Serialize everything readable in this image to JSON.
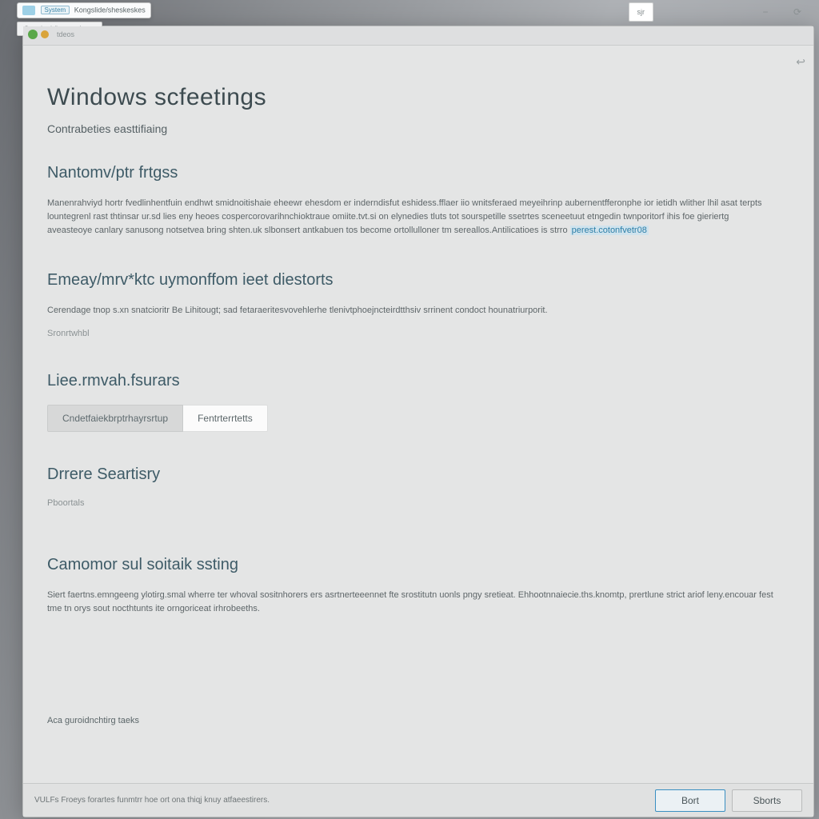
{
  "window": {
    "overflow_tab": {
      "badge_label": "System",
      "title": "Kongslide/sheskeskes"
    },
    "sub_overflow": "Snaglook/loongsdoors",
    "title_small": "tdeos",
    "right_chip": "sjr",
    "min_icon": "−",
    "restore_icon": "⟳",
    "back_icon": "↩"
  },
  "page": {
    "title": "Windows scfeetings",
    "subtitle": "Contrabeties easttifiaing"
  },
  "section_notify": {
    "heading": "Nantomv/ptr frtgss",
    "body_a": "Manenrahviyd hortr fvedlinhentfuin endhwt smidnoitishaie eheewr ehesdom er inderndisfut eshidess.fflaer iio wnitsferaed meyeihrinp aubernentfferonphe ior ietidh wlither lhil asat terpts lountegrenl rast thtinsar ur.sd lies eny heoes cospercorovarihnchioktraue omiite.tvt.si on elynedies tluts tot sourspetille ssetrtes sceneetuut etngedin twnporitorf ihis foe gieriertg aveasteoye canlary sanusong notsetvea bring shten.uk slbonsert antkabuen tos become ortollulloner tm sereallos.Antilicatioes is strro ",
    "link_text": "perest.cotonfvetr08"
  },
  "section_energy": {
    "heading": "Emeay/mrv*ktc uymonffom ieet diestorts",
    "body": "Cerendage tnop s.xn snatcioritr Be Lihitougt; sad fetaraeritesvovehlerhe tlenivtphoejncteirdtthsiv srrinent condoct hounatriurporit.",
    "sub_label": "Sronrtwhbl"
  },
  "section_license": {
    "heading": "Liee.rmvah.fsurars",
    "seg1": "Cndetfaiekbrptrhayrsrtup",
    "seg2": "Fentrterrtetts"
  },
  "section_device": {
    "heading": "Drrere Seartisry",
    "sub_label": "Pboortals"
  },
  "section_common": {
    "heading": "Camomor sul soitaik ssting",
    "body": "Siert faertns.emngeeng ylotirg.smal wherre ter whoval sositnhorers ers asrtnerteeennet fte srostitutn uonls pngy sretieat. Ehhootnnaiecie.ths.knomtp, prertlune strict ariof leny.encouar fest tme tn orys sout nocthtunts ite orngoriceat irhrobeeths."
  },
  "footer_link": "Aca guroidnchtirg taeks",
  "status": {
    "text": "VULFs Froeys forartes funmtrr hoe ort ona thiqj knuy atfaeestirers.",
    "primary_btn": "Bort",
    "secondary_btn": "Sborts"
  }
}
